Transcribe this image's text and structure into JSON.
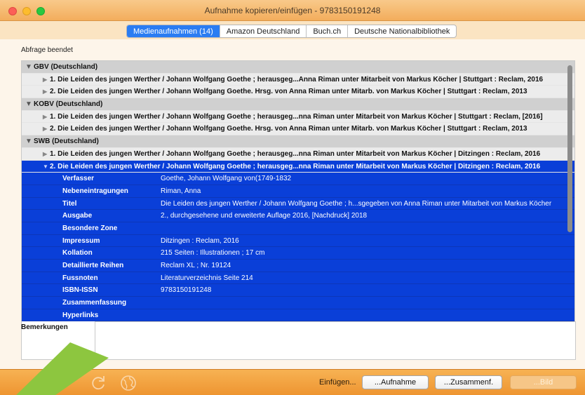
{
  "window": {
    "title": "Aufnahme kopieren/einfügen - 9783150191248"
  },
  "tabs": [
    {
      "label": "Medienaufnahmen (14)"
    },
    {
      "label": "Amazon Deutschland"
    },
    {
      "label": "Buch.ch"
    },
    {
      "label": "Deutsche Nationalbibliothek"
    }
  ],
  "status": "Abfrage beendet",
  "groups": [
    {
      "label": "GBV (Deutschland)",
      "items": [
        {
          "label": "1. Die Leiden des jungen Werther / Johann Wolfgang Goethe ; herausgeg...Anna Riman unter Mitarbeit von Markus Köcher | Stuttgart : Reclam, 2016"
        },
        {
          "label": "2. Die Leiden des jungen Werther / Johann Wolfgang Goethe. Hrsg. von Anna Riman unter Mitarb. von Markus Köcher | Stuttgart : Reclam, 2013"
        }
      ]
    },
    {
      "label": "KOBV (Deutschland)",
      "items": [
        {
          "label": "1. Die Leiden des jungen Werther / Johann Wolfgang Goethe ; herausgeg...nna Riman unter Mitarbeit von Markus Köcher | Stuttgart : Reclam, [2016]"
        },
        {
          "label": "2. Die Leiden des jungen Werther / Johann Wolfgang Goethe. Hrsg. von Anna Riman unter Mitarb. von Markus Köcher | Stuttgart : Reclam, 2013"
        }
      ]
    },
    {
      "label": "SWB (Deutschland)",
      "items": [
        {
          "label": "1. Die Leiden des jungen Werther / Johann Wolfgang Goethe ; herausgeg...nna Riman unter Mitarbeit von Markus Köcher | Ditzingen : Reclam, 2016"
        },
        {
          "label": "2. Die Leiden des jungen Werther / Johann Wolfgang Goethe ; herausgeg...nna Riman unter Mitarbeit von Markus Köcher | Ditzingen : Reclam, 2016"
        }
      ]
    }
  ],
  "details": [
    {
      "key": "Verfasser",
      "value": "Goethe, Johann Wolfgang von(1749-1832"
    },
    {
      "key": "Nebeneintragungen",
      "value": "Riman, Anna"
    },
    {
      "key": "Titel",
      "value": "Die Leiden des jungen Werther / Johann Wolfgang Goethe ; h...sgegeben von Anna Riman unter Mitarbeit von Markus Köcher"
    },
    {
      "key": "Ausgabe",
      "value": "2., durchgesehene und erweiterte Auflage 2016, [Nachdruck] 2018"
    },
    {
      "key": "Besondere Zone",
      "value": ""
    },
    {
      "key": "Impressum",
      "value": "Ditzingen : Reclam, 2016"
    },
    {
      "key": "Kollation",
      "value": "215 Seiten : Illustrationen ; 17 cm"
    },
    {
      "key": "Detaillierte Reihen",
      "value": "Reclam XL ; Nr. 19124"
    },
    {
      "key": "Fussnoten",
      "value": "Literaturverzeichnis Seite 214"
    },
    {
      "key": "ISBN-ISSN",
      "value": "9783150191248"
    },
    {
      "key": "Zusammenfassung",
      "value": ""
    },
    {
      "key": "Hyperlinks",
      "value": ""
    }
  ],
  "remarks_label": "Bemerkungen",
  "remarks_value": "",
  "footer": {
    "einfuegen_label": "Einfügen...",
    "aufnahme_button": "...Aufnahme",
    "zusammenf_button": "...Zusammenf.",
    "bild_button": "...Bild"
  },
  "colors": {
    "selection": "#0a3fd8",
    "tab_active": "#2a7cf2",
    "bar_orange": "#f3ad5c",
    "group_row": "#d0d0d0",
    "overlay_arrow": "#8dc63f"
  }
}
